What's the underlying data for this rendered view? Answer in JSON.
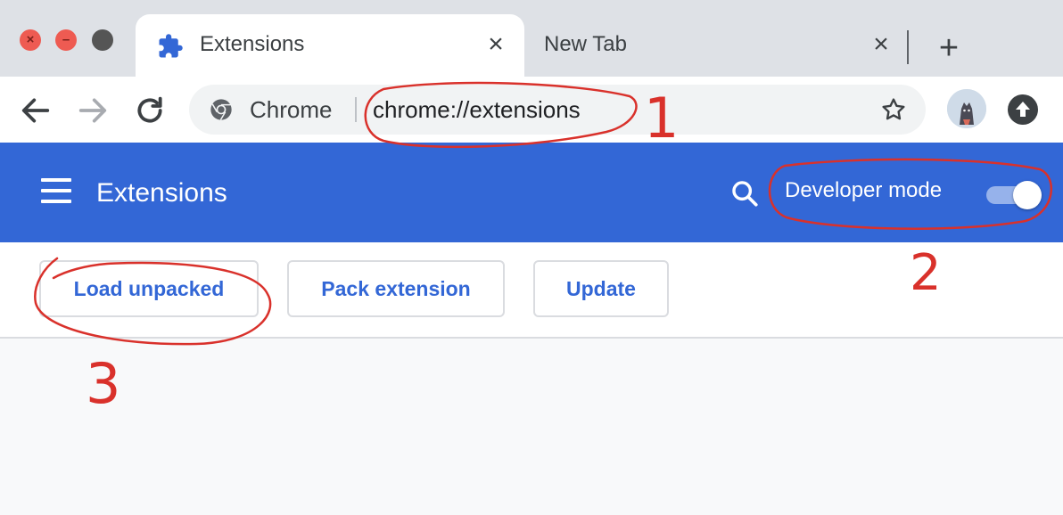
{
  "window": {
    "tabs": [
      {
        "title": "Extensions",
        "active": true,
        "icon": "puzzle-piece-icon"
      },
      {
        "title": "New Tab",
        "active": false
      }
    ]
  },
  "toolbar": {
    "origin_label": "Chrome",
    "url": "chrome://extensions"
  },
  "extensions_page": {
    "title": "Extensions",
    "developer_mode_label": "Developer mode",
    "developer_mode_on": true,
    "buttons": {
      "load_unpacked": "Load unpacked",
      "pack_extension": "Pack extension",
      "update": "Update"
    }
  },
  "annotations": {
    "step_1": "1",
    "step_2": "2",
    "step_3": "3",
    "color": "#d9312b"
  },
  "colors": {
    "header_blue": "#3367d6",
    "tabstrip_gray": "#dee1e6",
    "button_text": "#3367d6"
  }
}
